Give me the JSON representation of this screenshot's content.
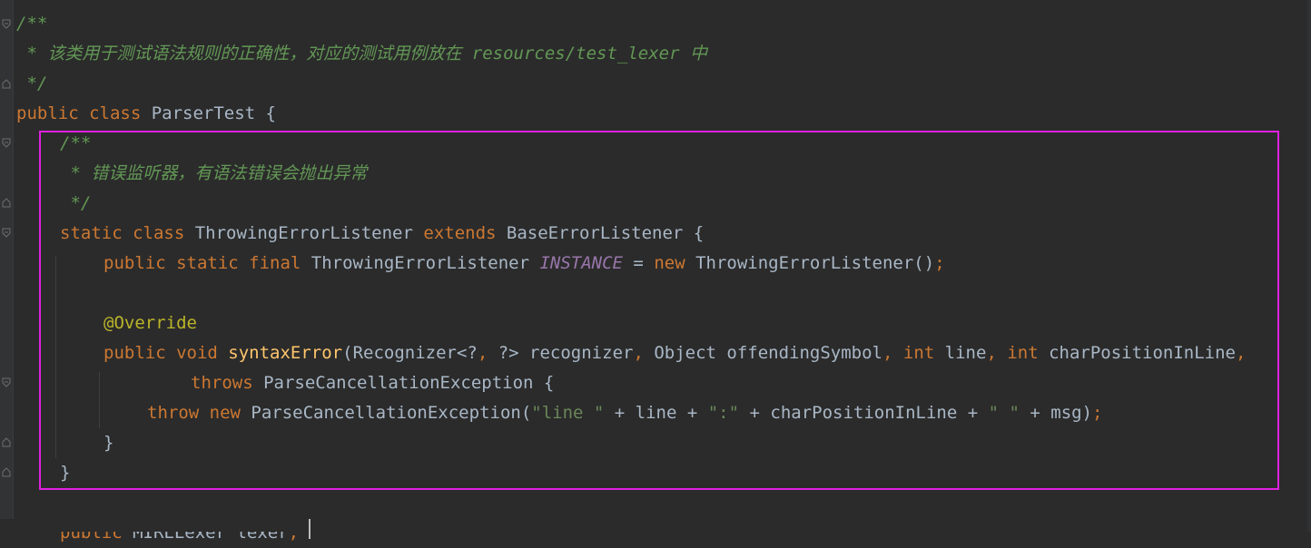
{
  "editor": {
    "lines": [
      {
        "indent": 0,
        "tokens": [
          {
            "t": "/**",
            "c": "c-doc"
          }
        ]
      },
      {
        "indent": 0,
        "tokens": [
          {
            "t": " * 该类用于测试语法规则的正确性，对应的测试用例放在 resources/test_lexer 中",
            "c": "c-doc"
          }
        ]
      },
      {
        "indent": 0,
        "tokens": [
          {
            "t": " */",
            "c": "c-doc"
          }
        ]
      },
      {
        "indent": 0,
        "tokens": [
          {
            "t": "public ",
            "c": "kw"
          },
          {
            "t": "class ",
            "c": "kw"
          },
          {
            "t": "ParserTest {",
            "c": "plain"
          }
        ]
      },
      {
        "indent": 1,
        "tokens": [
          {
            "t": "/**",
            "c": "c-doc"
          }
        ]
      },
      {
        "indent": 1,
        "tokens": [
          {
            "t": " * 错误监听器，有语法错误会抛出异常",
            "c": "c-doc"
          }
        ]
      },
      {
        "indent": 1,
        "tokens": [
          {
            "t": " */",
            "c": "c-doc"
          }
        ]
      },
      {
        "indent": 1,
        "tokens": [
          {
            "t": "static ",
            "c": "kw"
          },
          {
            "t": "class ",
            "c": "kw"
          },
          {
            "t": "ThrowingErrorListener ",
            "c": "plain"
          },
          {
            "t": "extends ",
            "c": "kw"
          },
          {
            "t": "BaseErrorListener {",
            "c": "plain"
          }
        ]
      },
      {
        "indent": 2,
        "tokens": [
          {
            "t": "public ",
            "c": "kw"
          },
          {
            "t": "static ",
            "c": "kw"
          },
          {
            "t": "final ",
            "c": "kw"
          },
          {
            "t": "ThrowingErrorListener ",
            "c": "plain"
          },
          {
            "t": "INSTANCE",
            "c": "static-field"
          },
          {
            "t": " = ",
            "c": "plain"
          },
          {
            "t": "new ",
            "c": "kw"
          },
          {
            "t": "ThrowingErrorListener()",
            "c": "plain"
          },
          {
            "t": ";",
            "c": "kw"
          }
        ]
      },
      {
        "indent": 0,
        "tokens": []
      },
      {
        "indent": 2,
        "tokens": [
          {
            "t": "@Override",
            "c": "ann"
          }
        ]
      },
      {
        "indent": 2,
        "tokens": [
          {
            "t": "public ",
            "c": "kw"
          },
          {
            "t": "void ",
            "c": "kw"
          },
          {
            "t": "syntaxError",
            "c": "fn"
          },
          {
            "t": "(Recognizer<?",
            "c": "plain"
          },
          {
            "t": ", ",
            "c": "kw"
          },
          {
            "t": "?> recognizer",
            "c": "plain"
          },
          {
            "t": ", ",
            "c": "kw"
          },
          {
            "t": "Object offendingSymbol",
            "c": "plain"
          },
          {
            "t": ", ",
            "c": "kw"
          },
          {
            "t": "int ",
            "c": "kw"
          },
          {
            "t": "line",
            "c": "plain"
          },
          {
            "t": ", ",
            "c": "kw"
          },
          {
            "t": "int ",
            "c": "kw"
          },
          {
            "t": "charPositionInLine",
            "c": "plain"
          },
          {
            "t": ",",
            "c": "kw"
          }
        ]
      },
      {
        "indent": 4,
        "tokens": [
          {
            "t": "throws ",
            "c": "kw"
          },
          {
            "t": "ParseCancellationException {",
            "c": "plain"
          }
        ]
      },
      {
        "indent": 3,
        "tokens": [
          {
            "t": "throw ",
            "c": "kw"
          },
          {
            "t": "new ",
            "c": "kw"
          },
          {
            "t": "ParseCancellationException(",
            "c": "plain"
          },
          {
            "t": "\"line \"",
            "c": "str"
          },
          {
            "t": " + line + ",
            "c": "plain"
          },
          {
            "t": "\":\"",
            "c": "str"
          },
          {
            "t": " + charPositionInLine + ",
            "c": "plain"
          },
          {
            "t": "\" \"",
            "c": "str"
          },
          {
            "t": " + msg)",
            "c": "plain"
          },
          {
            "t": ";",
            "c": "kw"
          }
        ]
      },
      {
        "indent": 2,
        "tokens": [
          {
            "t": "}",
            "c": "plain"
          }
        ]
      },
      {
        "indent": 1,
        "tokens": [
          {
            "t": "}",
            "c": "plain"
          }
        ]
      },
      {
        "indent": 0,
        "tokens": []
      },
      {
        "indent": 1,
        "tokens": [
          {
            "t": "public ",
            "c": "kw"
          },
          {
            "t": "MIRLLexer lexer",
            "c": "plain"
          },
          {
            "t": ";",
            "c": "kw"
          }
        ]
      }
    ]
  },
  "colors": {
    "background": "#2b2b2b",
    "keyword": "#cc7832",
    "doc_comment": "#629755",
    "annotation": "#bbb529",
    "method": "#ffc66d",
    "static_field": "#9876aa",
    "string": "#6a8759",
    "text": "#a9b7c6",
    "highlight_border": "#e020e0"
  }
}
